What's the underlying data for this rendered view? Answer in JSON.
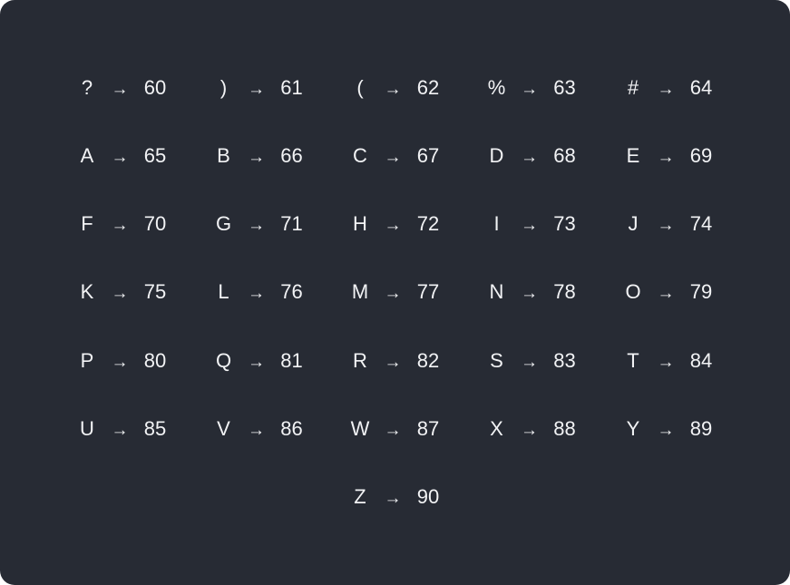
{
  "arrow": "→",
  "mappings": [
    {
      "char": "?",
      "code": "60"
    },
    {
      "char": ")",
      "code": "61"
    },
    {
      "char": "(",
      "code": "62"
    },
    {
      "char": "%",
      "code": "63"
    },
    {
      "char": "#",
      "code": "64"
    },
    {
      "char": "A",
      "code": "65"
    },
    {
      "char": "B",
      "code": "66"
    },
    {
      "char": "C",
      "code": "67"
    },
    {
      "char": "D",
      "code": "68"
    },
    {
      "char": "E",
      "code": "69"
    },
    {
      "char": "F",
      "code": "70"
    },
    {
      "char": "G",
      "code": "71"
    },
    {
      "char": "H",
      "code": "72"
    },
    {
      "char": "I",
      "code": "73"
    },
    {
      "char": "J",
      "code": "74"
    },
    {
      "char": "K",
      "code": "75"
    },
    {
      "char": "L",
      "code": "76"
    },
    {
      "char": "M",
      "code": "77"
    },
    {
      "char": "N",
      "code": "78"
    },
    {
      "char": "O",
      "code": "79"
    },
    {
      "char": "P",
      "code": "80"
    },
    {
      "char": "Q",
      "code": "81"
    },
    {
      "char": "R",
      "code": "82"
    },
    {
      "char": "S",
      "code": "83"
    },
    {
      "char": "T",
      "code": "84"
    },
    {
      "char": "U",
      "code": "85"
    },
    {
      "char": "V",
      "code": "86"
    },
    {
      "char": "W",
      "code": "87"
    },
    {
      "char": "X",
      "code": "88"
    },
    {
      "char": "Y",
      "code": "89"
    },
    {
      "char": "Z",
      "code": "90"
    }
  ],
  "colors": {
    "background": "#272b34",
    "text": "#f2f3f5"
  }
}
